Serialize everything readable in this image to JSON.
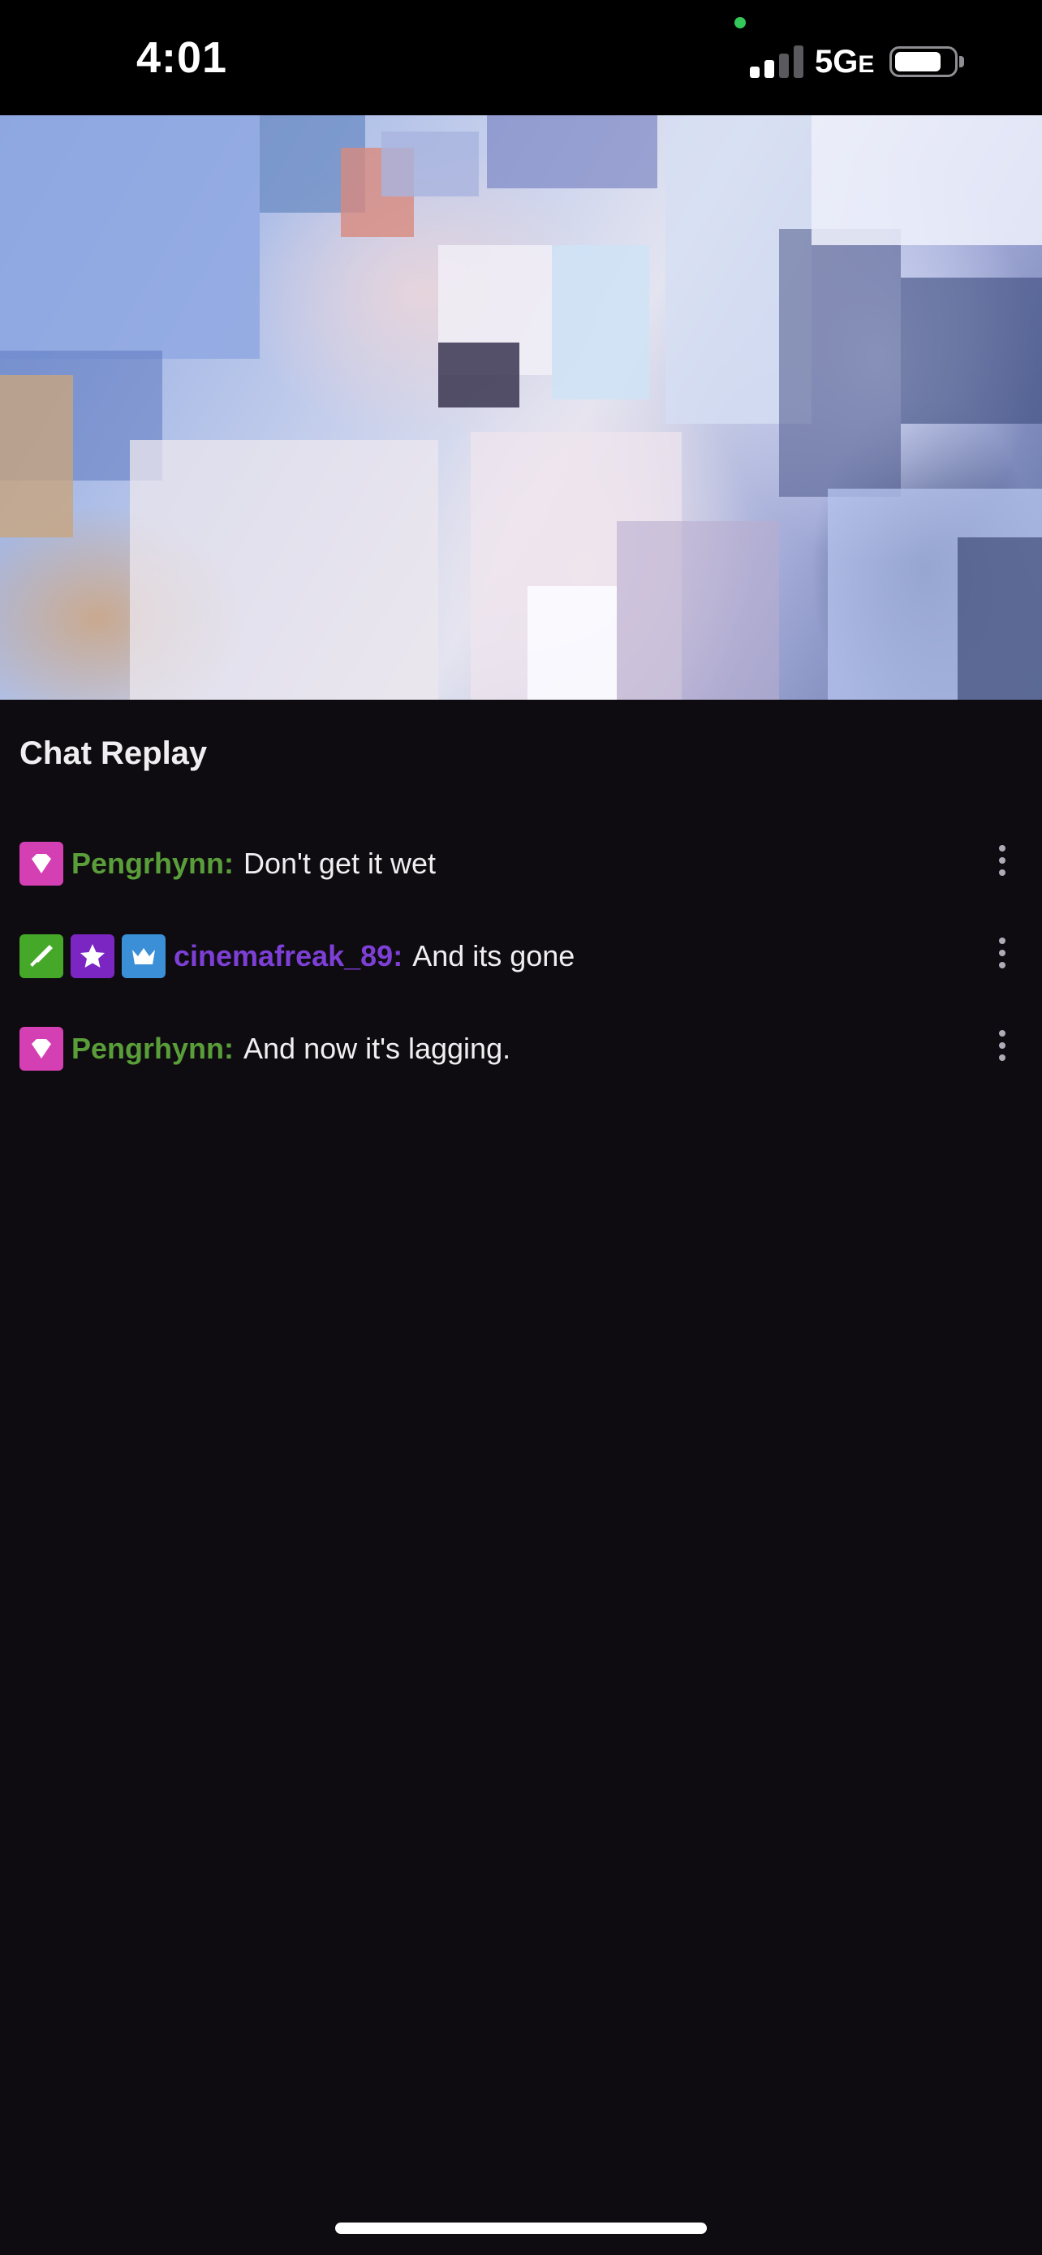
{
  "status_bar": {
    "time": "4:01",
    "network": "5G",
    "network_suffix": "E",
    "signal_bars_active": 2,
    "signal_bars_total": 4,
    "battery_level": 0.8
  },
  "video": {
    "icon": "video-frame"
  },
  "chat": {
    "title": "Chat Replay",
    "messages": [
      {
        "badges": [
          {
            "name": "gem-badge",
            "color": "#d43fb4"
          }
        ],
        "username": "Pengrhynn:",
        "username_color": "#5a9e3a",
        "text": "Don't get it wet"
      },
      {
        "badges": [
          {
            "name": "sword-badge",
            "color": "#45a828"
          },
          {
            "name": "star-badge",
            "color": "#7b26c2"
          },
          {
            "name": "crown-badge",
            "color": "#3a8fd6"
          }
        ],
        "username": "cinemafreak_89:",
        "username_color": "#7d3fd6",
        "text": "And its gone"
      },
      {
        "badges": [
          {
            "name": "gem-badge",
            "color": "#d43fb4"
          }
        ],
        "username": "Pengrhynn:",
        "username_color": "#5a9e3a",
        "text": "And now it's lagging."
      }
    ]
  }
}
